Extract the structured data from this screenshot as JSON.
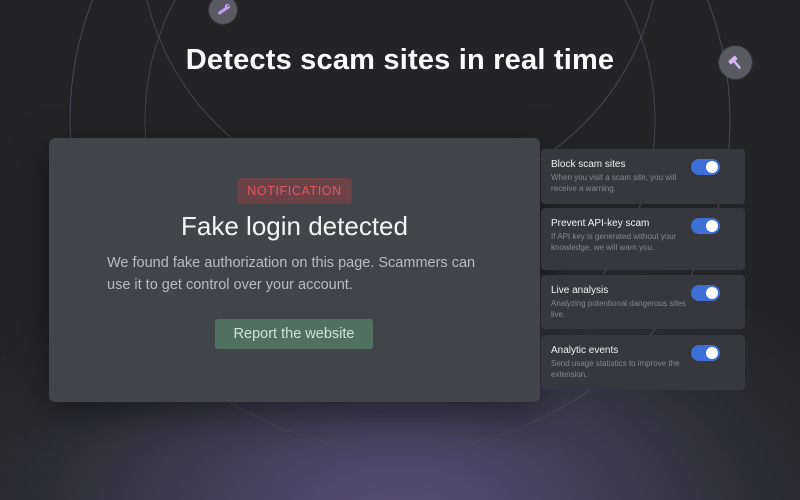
{
  "headline": "Detects scam sites in real time",
  "orbit_icons": [
    {
      "icon": "wrench-icon",
      "color": "#c49ef5"
    },
    {
      "icon": "hammer-icon",
      "color": "#d4b9f7"
    }
  ],
  "notification": {
    "tag": "NOTIFICATION",
    "title": "Fake login detected",
    "description": "We found fake authorization on this page. Scammers can use it to get control over your account.",
    "button_label": "Report the website"
  },
  "settings": [
    {
      "name": "Block scam sites",
      "description": "When you visit a scam site, you will receive a warning.",
      "enabled": true
    },
    {
      "name": "Prevent API-key scam",
      "description": "If API key is generated without your knowledge, we will warn you.",
      "enabled": true
    },
    {
      "name": "Live analysis",
      "description": "Analyzing potentional dangerous sites live.",
      "enabled": true
    },
    {
      "name": "Analytic events",
      "description": "Send usage statistics to improve the extension.",
      "enabled": true
    }
  ],
  "colors": {
    "accent": "#3d6fd6",
    "tag_bg": "#6b4347",
    "tag_text": "#e2585d",
    "button_bg": "#52705f",
    "card_bg": "#414448"
  }
}
